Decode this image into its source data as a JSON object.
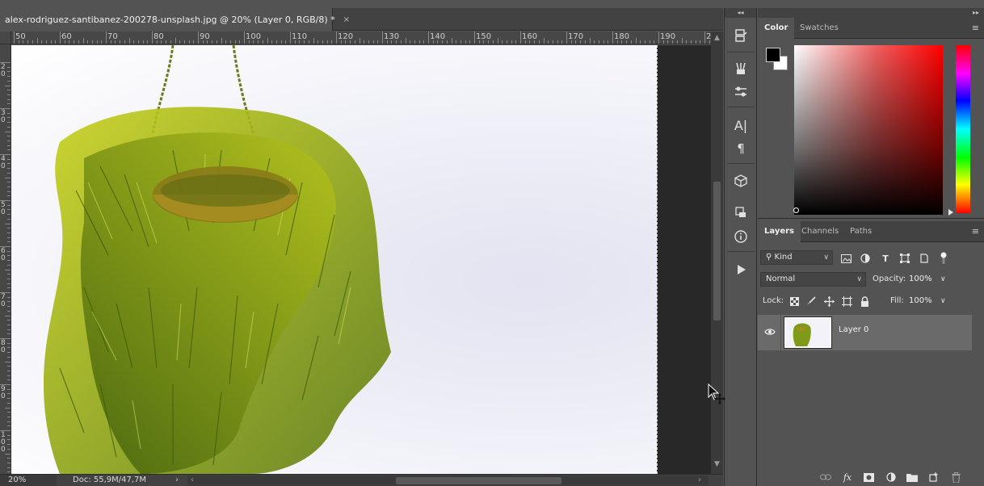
{
  "document_tab": {
    "title": "alex-rodriguez-santibanez-200278-unsplash.jpg @ 20% (Layer 0, RGB/8) *",
    "close_glyph": "×"
  },
  "ruler_top": {
    "labels": [
      "50",
      "60",
      "70",
      "80",
      "90",
      "100",
      "110",
      "120",
      "130",
      "140",
      "150",
      "160",
      "170",
      "180",
      "190",
      "20"
    ]
  },
  "ruler_left": {
    "labels": [
      "2 0",
      "3 0",
      "4 0",
      "5 0",
      "6 0",
      "7 0",
      "8 0",
      "9 0",
      "1 0 0"
    ]
  },
  "statusbar": {
    "zoom": "20%",
    "doc_info": "Doc: 55,9M/47,7M",
    "arrow": "›"
  },
  "toolstrip": {
    "collapse_glyph": "◂◂",
    "tools": [
      "history-brush-icon",
      "brush-presets-icon",
      "adjustments-sliders-icon",
      "character-icon",
      "paragraph-icon",
      "3d-cube-icon",
      "3d-materials-icon",
      "info-icon",
      "play-actions-icon"
    ]
  },
  "panels": {
    "collapse_glyph": "▸▸",
    "color_tabs": [
      "Color",
      "Swatches"
    ],
    "color_active": "Color",
    "foreground_color": "#000000",
    "background_color": "#ffffff",
    "layers_tabs": [
      "Layers",
      "Channels",
      "Paths"
    ],
    "layers_active": "Layers"
  },
  "layers": {
    "filter_kind": "Kind",
    "blend_mode": "Normal",
    "opacity_label": "Opacity:",
    "opacity_value": "100%",
    "lock_label": "Lock:",
    "fill_label": "Fill:",
    "fill_value": "100%",
    "items": [
      {
        "name": "Layer 0",
        "visible": true,
        "selected": true
      }
    ]
  }
}
